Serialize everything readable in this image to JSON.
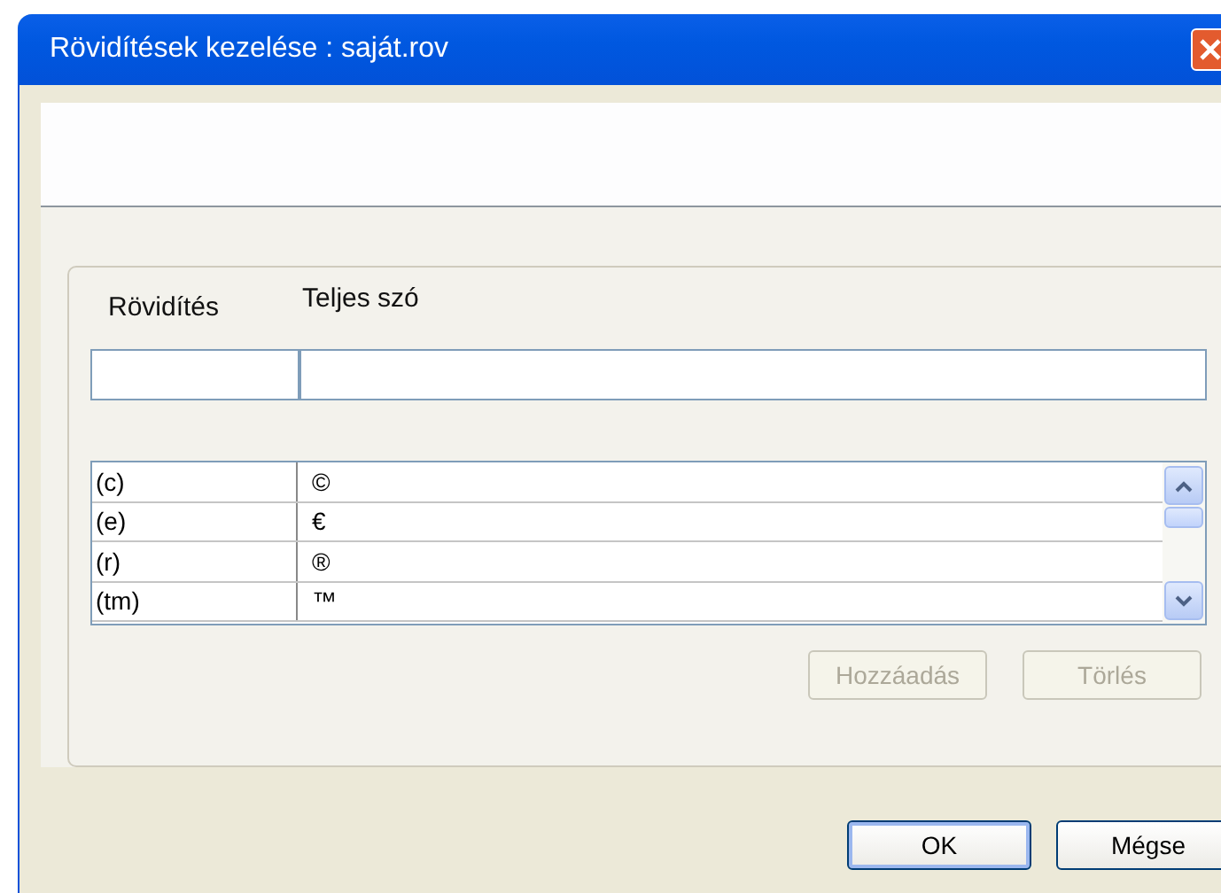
{
  "window": {
    "title": "Rövidítések kezelése : saját.rov"
  },
  "columns": [
    "Rövidítés",
    "Teljes szó"
  ],
  "rows": [
    {
      "abbreviation": "(c)",
      "full_word": "©"
    },
    {
      "abbreviation": "(e)",
      "full_word": "€"
    },
    {
      "abbreviation": "(r)",
      "full_word": "®"
    },
    {
      "abbreviation": "(tm)",
      "full_word": "™"
    }
  ],
  "list_buttons": [
    {
      "label": "Hozzáadás",
      "disabled": true
    },
    {
      "label": "Törlés",
      "disabled": true
    }
  ],
  "dialog_buttons": [
    {
      "label": "OK",
      "default": true
    },
    {
      "label": "Mégse",
      "default": false
    }
  ]
}
